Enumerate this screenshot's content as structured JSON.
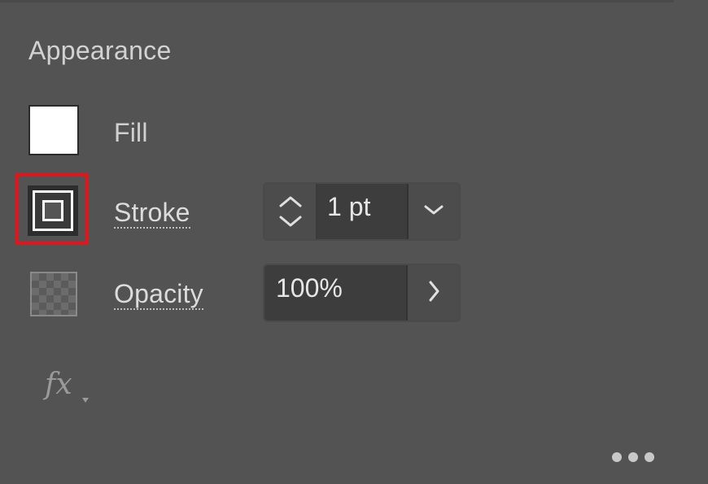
{
  "panel": {
    "title": "Appearance"
  },
  "rows": {
    "fill": {
      "label": "Fill",
      "swatch_color": "#ffffff"
    },
    "stroke": {
      "label": "Stroke",
      "weight_value": "1 pt",
      "highlight_color": "#e3141b"
    },
    "opacity": {
      "label": "Opacity",
      "value": "100%"
    }
  },
  "icons": {
    "stepper_up": "chevron-up-icon",
    "stepper_down": "chevron-down-icon",
    "dropdown": "chevron-down-icon",
    "flyout": "chevron-right-icon",
    "fx": "fx-icon",
    "more": "more-options-icon"
  },
  "fx_label": "fx"
}
